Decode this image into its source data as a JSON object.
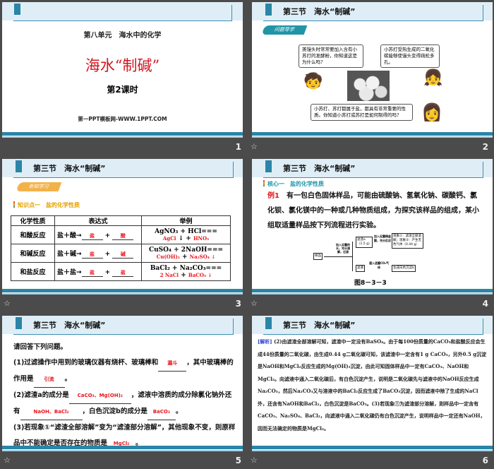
{
  "section_title": "第三节　海水“制碱”",
  "slides": [
    {
      "number": "1",
      "unit": "第八单元　海水中的化学",
      "title": "海水“制碱”",
      "lesson": "第2课时",
      "site": "第一PPT模板网-WWW.1PPT.COM"
    },
    {
      "number": "2",
      "tag": "问题导学",
      "bubble1": "蒸馒头时常常要加入含有小苏打的发酵粉，你知道这是为什么吗?",
      "bubble2": "小苏打受热生成的二氧化碳能够使馒头变得疏松多孔。",
      "bubble3": "小苏打、苏打都属于盐，都具有非常重要的性质。你知道小苏打或苏打是如何制得的吗?"
    },
    {
      "number": "3",
      "tag": "新知学习",
      "knowledge": "知识点一　盐的化学性质",
      "headers": [
        "化学性质",
        "表达式",
        "举例"
      ],
      "rows": [
        {
          "prop": "和酸反应",
          "expr": "盐＋酸→",
          "a1": "盐",
          "a2": "酸",
          "ex1": "AgNO₃ + HCl===",
          "ex2": "AgCl",
          "ex2b": "↓ +",
          "ex3": "HNO₃"
        },
        {
          "prop": "和碱反应",
          "expr": "盐＋碱→",
          "a1": "盐",
          "a2": "碱",
          "ex1": "CuSO₄ + 2NaOH===",
          "ex2": "Cu(OH)₂",
          "ex2b": "+",
          "ex3": "Na₂SO₄ ↓"
        },
        {
          "prop": "和盐反应",
          "expr": "盐＋盐→",
          "a1": "盐",
          "a2": "盐",
          "ex1": "BaCl₂ + Na₂CO₃===",
          "ex2": "2 NaCl",
          "ex2b": "+",
          "ex3": "BaCO₃ ↓"
        }
      ]
    },
    {
      "number": "4",
      "core": "核心一　盐的化学性质",
      "example_label": "例1",
      "example_text": "有一包白色固体样品，可能由硫酸钠、氢氧化钠、碳酸钙、氯化钡、氯化镁中的一种或几种物质组成，为探究该样品的组成，某小组取适量样品按下列流程进行实验。",
      "flow": {
        "sample": "样品",
        "step1": "加入足量的水，充分溶解，过滤",
        "residue": "滤渣a（1.5 g）",
        "step2": "加入足量稀盐酸，充分反应",
        "result": "现象①：滤渣全部溶解；现象②：产生无色气体（0.44 g）",
        "filtrate": "滤液",
        "step3": "通入适量CO₂气体",
        "result2": "生成白色沉淀b"
      },
      "figure": "图8－3－3"
    },
    {
      "number": "5",
      "intro": "请回答下列问题。",
      "q1a": "(1)过滤操作中用到的玻璃仪器有烧杯、玻璃棒和",
      "q1_ans1": "漏斗",
      "q1b": "，其中玻璃棒的作用是",
      "q1_ans2": "引流",
      "end": "。",
      "q2a": "(2)滤渣a的成分是",
      "q2_ans1": "CaCO₃、Mg(OH)₂",
      "q2b": "，滤液中溶质的成分除氯化钠外还有",
      "q2_ans2": "NaOH、BaCl₂",
      "q2c": "，白色沉淀b的成分是",
      "q2_ans3": "BaCO₃",
      "q3a": "(3)若现象①“滤渣全部溶解”变为“滤渣部分溶解”，其他现象不变，则原样品中不能确定是否存在的物质是",
      "q3_ans": "MgCl₂"
    },
    {
      "number": "6",
      "label": "[解析]",
      "text": "(2)由滤渣全部溶解可知，滤渣中一定没有BaSO₄。由于每100份质量的CaCO₃和盐酸反应会生成44份质量的二氧化碳，由生成0.44 g二氧化碳可知，该滤渣中一定含有1 g CaCO₃，另外0.5 g沉淀是NaOH和MgCl₂反应生成的Mg(OH)₂沉淀，由此可知固体样品中一定有CaCO₃、NaOH和MgCl₂。向滤液中通入二氧化碳后，有白色沉淀产生，说明是二氧化碳先与滤液中的NaOH反应生成Na₂CO₃，然后Na₂CO₃又与溶液中的BaCl₂反应生成了BaCO₃沉淀，因而滤液中除了生成的NaCl外，还含有NaOH和BaCl₂，白色沉淀是BaCO₃。(3)若现象①为滤渣部分溶解，则样品中一定含有CaCO₃、Na₂SO₄、BaCl₂，向滤液中通入二氧化碳仍有白色沉淀产生，说明样品中一定还有NaOH，因而无法确定的物质是MgCl₂。"
    }
  ],
  "colors": {
    "accent": "#2a85a6",
    "red": "#e8141c",
    "orange": "#e6a100"
  }
}
